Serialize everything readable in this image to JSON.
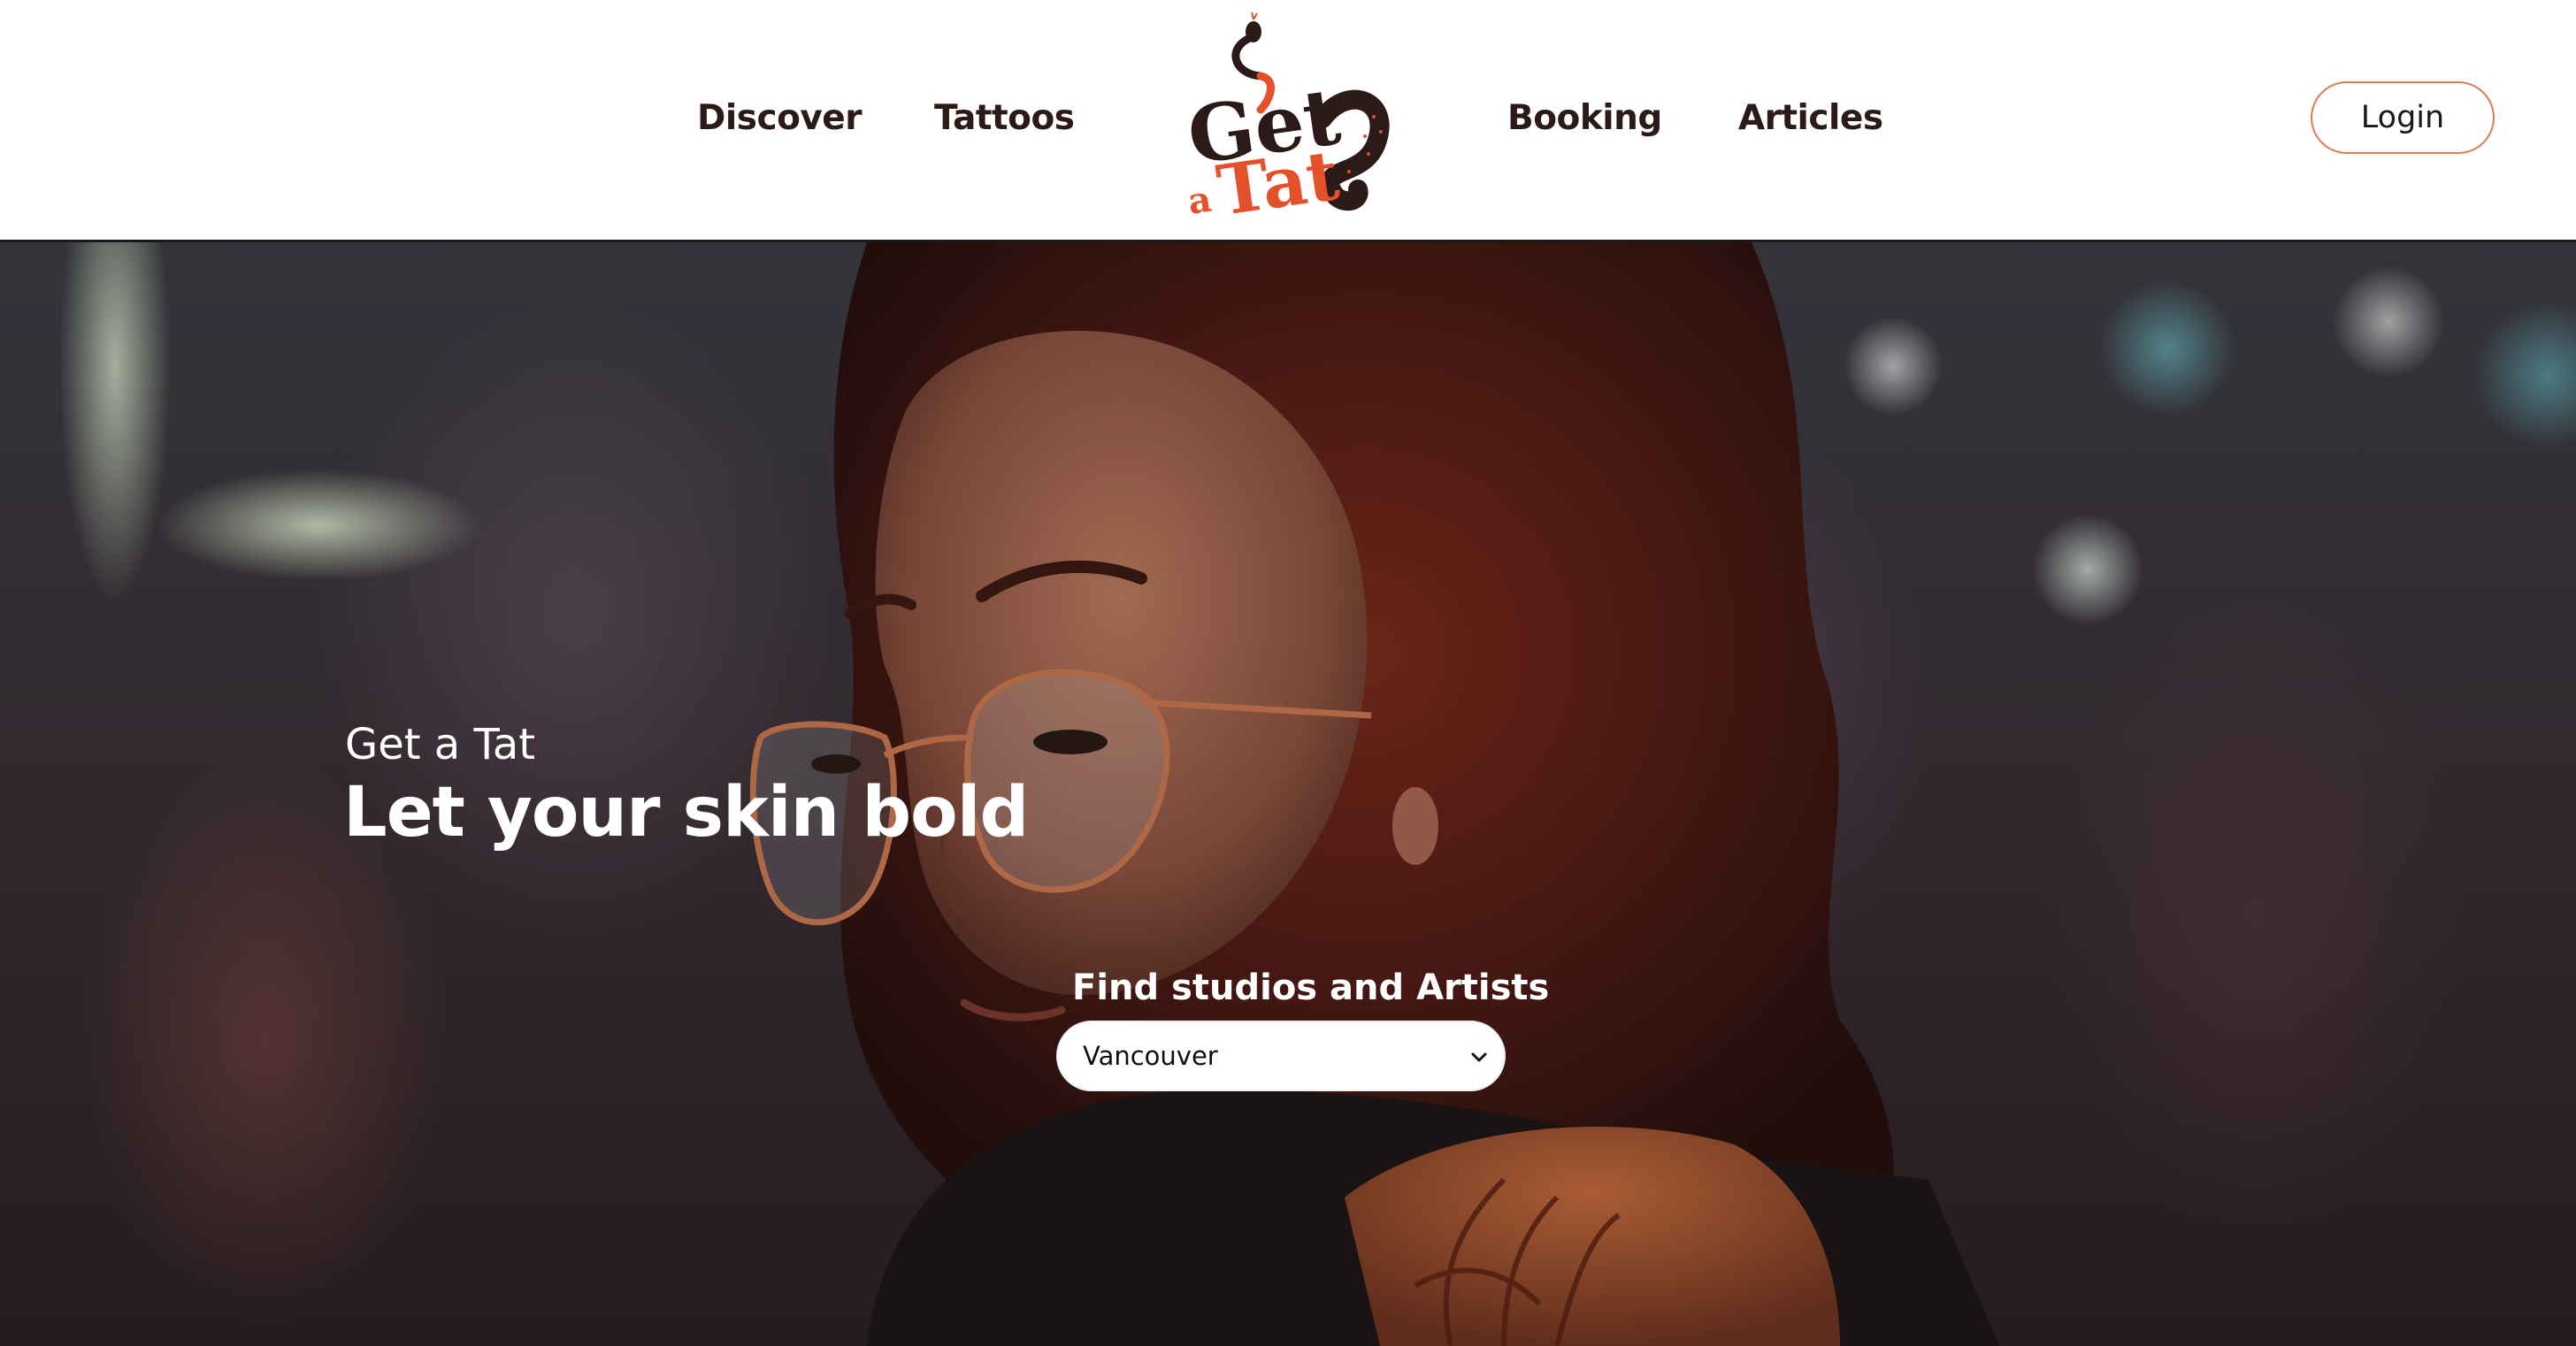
{
  "header": {
    "nav_left": [
      {
        "label": "Discover"
      },
      {
        "label": "Tattoos"
      }
    ],
    "nav_right": [
      {
        "label": "Booking"
      },
      {
        "label": "Articles"
      }
    ],
    "logo": {
      "text_line1": "Get",
      "text_line2_prefix": "a",
      "text_line2": "Tat",
      "icon": "snake-icon",
      "colors": {
        "dark": "#2b1a17",
        "accent": "#e4502a"
      }
    },
    "login_label": "Login"
  },
  "hero": {
    "eyebrow": "Get a Tat",
    "headline": "Let your skin bold",
    "search": {
      "label": "Find studios and Artists",
      "selected_city": "Vancouver",
      "icon": "chevron-down-icon"
    }
  },
  "colors": {
    "accent": "#e07a52",
    "nav_text": "#2b1a17",
    "header_bg": "#ffffff",
    "hero_text": "#ffffff"
  }
}
